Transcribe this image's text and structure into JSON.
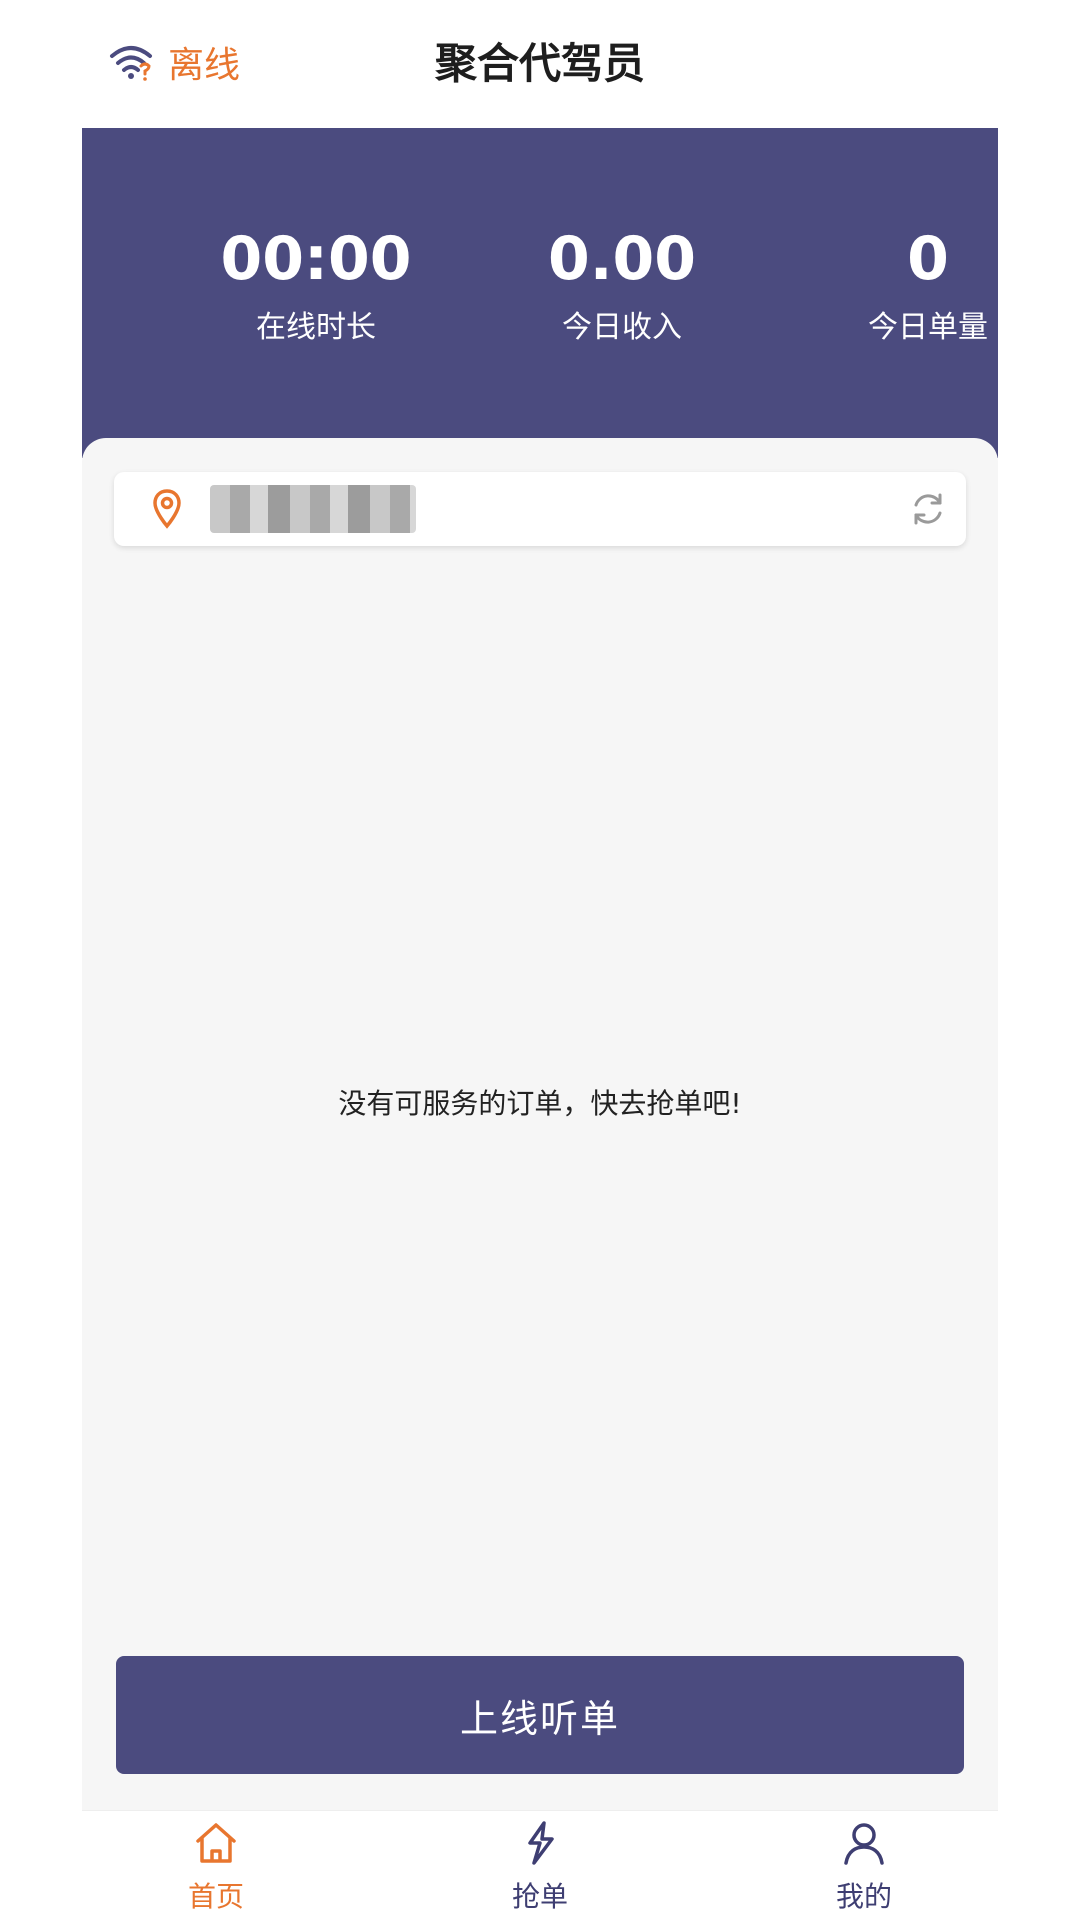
{
  "header": {
    "status_label": "离线",
    "title": "聚合代驾员",
    "status_icon": "wifi-icon"
  },
  "stats": {
    "online_duration": {
      "value": "00:00",
      "label": "在线时长"
    },
    "today_income": {
      "value": "0.00",
      "label": "今日收入"
    },
    "today_orders": {
      "value": "0",
      "label": "今日单量"
    }
  },
  "location": {
    "address": "",
    "pin_icon": "location-pin-icon",
    "refresh_icon": "refresh-icon"
  },
  "empty_message": "没有可服务的订单，快去抢单吧!",
  "online_button_label": "上线听单",
  "nav": {
    "items": [
      {
        "label": "首页",
        "icon": "home-icon",
        "active": true
      },
      {
        "label": "抢单",
        "icon": "lightning-icon",
        "active": false
      },
      {
        "label": "我的",
        "icon": "user-icon",
        "active": false
      }
    ]
  },
  "colors": {
    "primary": "#4B4B7F",
    "accent": "#E8762F",
    "background": "#F6F6F6"
  }
}
